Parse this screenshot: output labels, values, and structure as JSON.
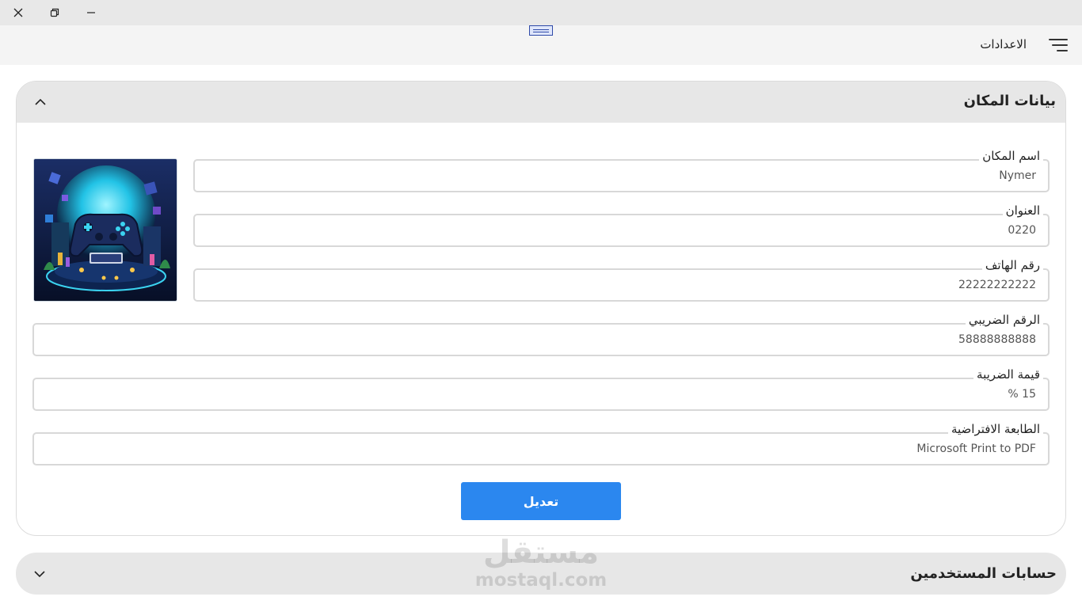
{
  "window": {
    "close_icon": "close-icon",
    "restore_icon": "restore-icon",
    "minimize_icon": "minimize-icon"
  },
  "appbar": {
    "title": "الاعدادات",
    "menu_icon": "hamburger-menu-icon"
  },
  "place_panel": {
    "title": "بيانات المكان",
    "expanded": true,
    "image": "gamepad-neon-illustration",
    "fields": [
      {
        "label": "اسم المكان",
        "value": "Nymer"
      },
      {
        "label": "العنوان",
        "value": "0220"
      },
      {
        "label": "رقم الهاتف",
        "value": "22222222222"
      },
      {
        "label": "الرقم الضريبي",
        "value": "58888888888"
      },
      {
        "label": "قيمة الضريبة",
        "value": "% 15"
      },
      {
        "label": "الطابعة الافتراضية",
        "value": "Microsoft Print to PDF"
      }
    ],
    "edit_button": "تعديل"
  },
  "users_panel": {
    "title": "حسابات المستخدمين",
    "expanded": false
  },
  "watermark": {
    "arabic": "مستقل",
    "latin": "mostaql.com"
  },
  "colors": {
    "accent": "#2b87ef",
    "panel_header": "#e7e7e7",
    "titlebar": "#e8e8e8"
  }
}
